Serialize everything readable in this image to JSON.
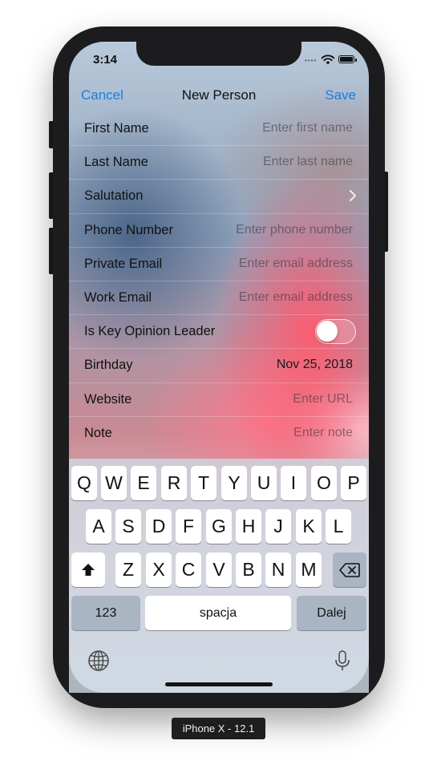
{
  "status_bar": {
    "time": "3:14"
  },
  "navbar": {
    "cancel": "Cancel",
    "title": "New Person",
    "save": "Save"
  },
  "form": {
    "rows": [
      {
        "label": "First Name",
        "placeholder": "Enter first name"
      },
      {
        "label": "Last Name",
        "placeholder": "Enter last name"
      },
      {
        "label": "Salutation"
      },
      {
        "label": "Phone Number",
        "placeholder": "Enter phone number"
      },
      {
        "label": "Private Email",
        "placeholder": "Enter email address"
      },
      {
        "label": "Work Email",
        "placeholder": "Enter email address"
      },
      {
        "label": "Is Key Opinion Leader",
        "toggle_on": false
      },
      {
        "label": "Birthday",
        "value": "Nov 25, 2018"
      },
      {
        "label": "Website",
        "placeholder": "Enter URL"
      },
      {
        "label": "Note",
        "placeholder": "Enter note"
      }
    ]
  },
  "keyboard": {
    "row1": [
      "Q",
      "W",
      "E",
      "R",
      "T",
      "Y",
      "U",
      "I",
      "O",
      "P"
    ],
    "row2": [
      "A",
      "S",
      "D",
      "F",
      "G",
      "H",
      "J",
      "K",
      "L"
    ],
    "row3": [
      "Z",
      "X",
      "C",
      "V",
      "B",
      "N",
      "M"
    ],
    "numbers": "123",
    "space": "spacja",
    "next": "Dalej",
    "icons": [
      "shift-icon",
      "backspace-icon",
      "globe-icon",
      "microphone-icon"
    ]
  },
  "device_label": "iPhone X - 12.1",
  "colors": {
    "accent": "#1a7fe0"
  }
}
